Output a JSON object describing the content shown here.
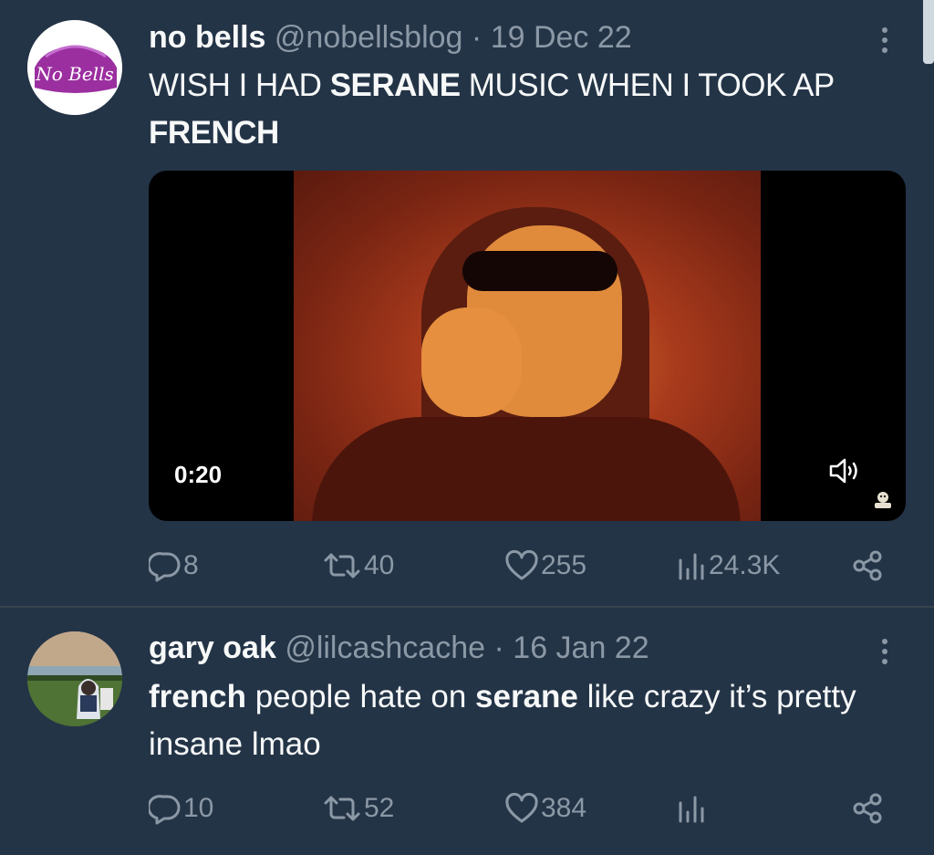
{
  "tweets": [
    {
      "avatar_text": "No Bells",
      "name": "no bells",
      "handle": "@nobellsblog",
      "separator": "·",
      "date": "19 Dec 22",
      "text_parts": [
        {
          "text": "WISH I HAD ",
          "bold": false
        },
        {
          "text": "SERANE",
          "bold": true
        },
        {
          "text": " MUSIC WHEN I TOOK AP ",
          "bold": false
        },
        {
          "text": "FRENCH",
          "bold": true
        }
      ],
      "media": {
        "duration": "0:20"
      },
      "actions": {
        "replies": "8",
        "retweets": "40",
        "likes": "255",
        "views": "24.3K"
      }
    },
    {
      "name": "gary oak",
      "handle": "@lilcashcache",
      "separator": "·",
      "date": "16 Jan 22",
      "text_parts": [
        {
          "text": "french",
          "bold": true
        },
        {
          "text": " people hate on ",
          "bold": false
        },
        {
          "text": "serane",
          "bold": true
        },
        {
          "text": " like crazy it’s pretty insane lmao",
          "bold": false
        }
      ],
      "actions": {
        "replies": "10",
        "retweets": "52",
        "likes": "384",
        "views": ""
      }
    }
  ],
  "colors": {
    "background": "#243447",
    "text_primary": "#f7f9f9",
    "text_secondary": "#8b98a5",
    "divider": "#38444d",
    "avatar_brand": "#9b2fa0"
  },
  "icons": [
    "more-icon",
    "reply-icon",
    "retweet-icon",
    "like-icon",
    "views-icon",
    "share-icon",
    "volume-icon"
  ]
}
